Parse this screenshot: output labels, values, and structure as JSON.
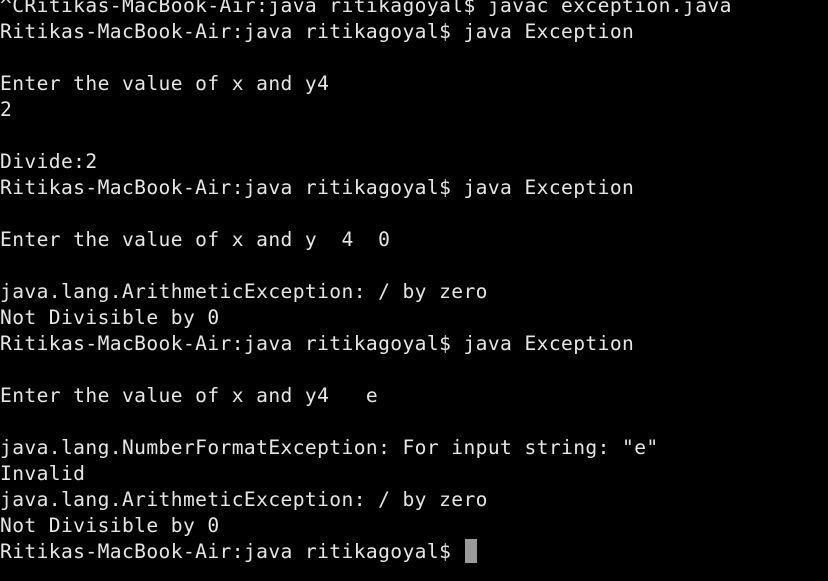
{
  "terminal": {
    "lines": [
      "^CRitikas-MacBook-Air:java ritikagoyal$ javac exception.java",
      "Ritikas-MacBook-Air:java ritikagoyal$ java Exception",
      "",
      "Enter the value of x and y4",
      "2",
      "",
      "Divide:2",
      "Ritikas-MacBook-Air:java ritikagoyal$ java Exception",
      "",
      "Enter the value of x and y  4  0",
      "",
      "java.lang.ArithmeticException: / by zero",
      "Not Divisible by 0",
      "Ritikas-MacBook-Air:java ritikagoyal$ java Exception",
      "",
      "Enter the value of x and y4   e",
      "",
      "java.lang.NumberFormatException: For input string: \"e\"",
      "Invalid",
      "java.lang.ArithmeticException: / by zero",
      "Not Divisible by 0"
    ],
    "current_prompt": "Ritikas-MacBook-Air:java ritikagoyal$ "
  },
  "colors": {
    "background": "#000000",
    "text": "#e6e6e6",
    "cursor": "#9a9a9a"
  }
}
